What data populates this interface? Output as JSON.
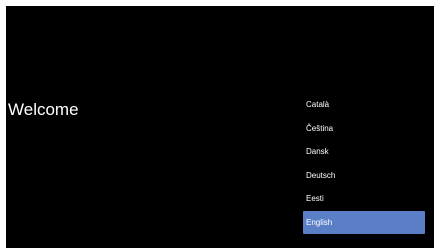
{
  "welcome": {
    "title": "Welcome"
  },
  "languages": {
    "items": [
      {
        "label": "Català"
      },
      {
        "label": "Čeština"
      },
      {
        "label": "Dansk"
      },
      {
        "label": "Deutsch"
      },
      {
        "label": "Eesti"
      },
      {
        "label": "English",
        "selected": true
      }
    ],
    "selected_color": "#5b7fc7"
  },
  "colors": {
    "screen_background": "#000000",
    "text": "#ffffff",
    "highlight": "#5b7fc7"
  }
}
